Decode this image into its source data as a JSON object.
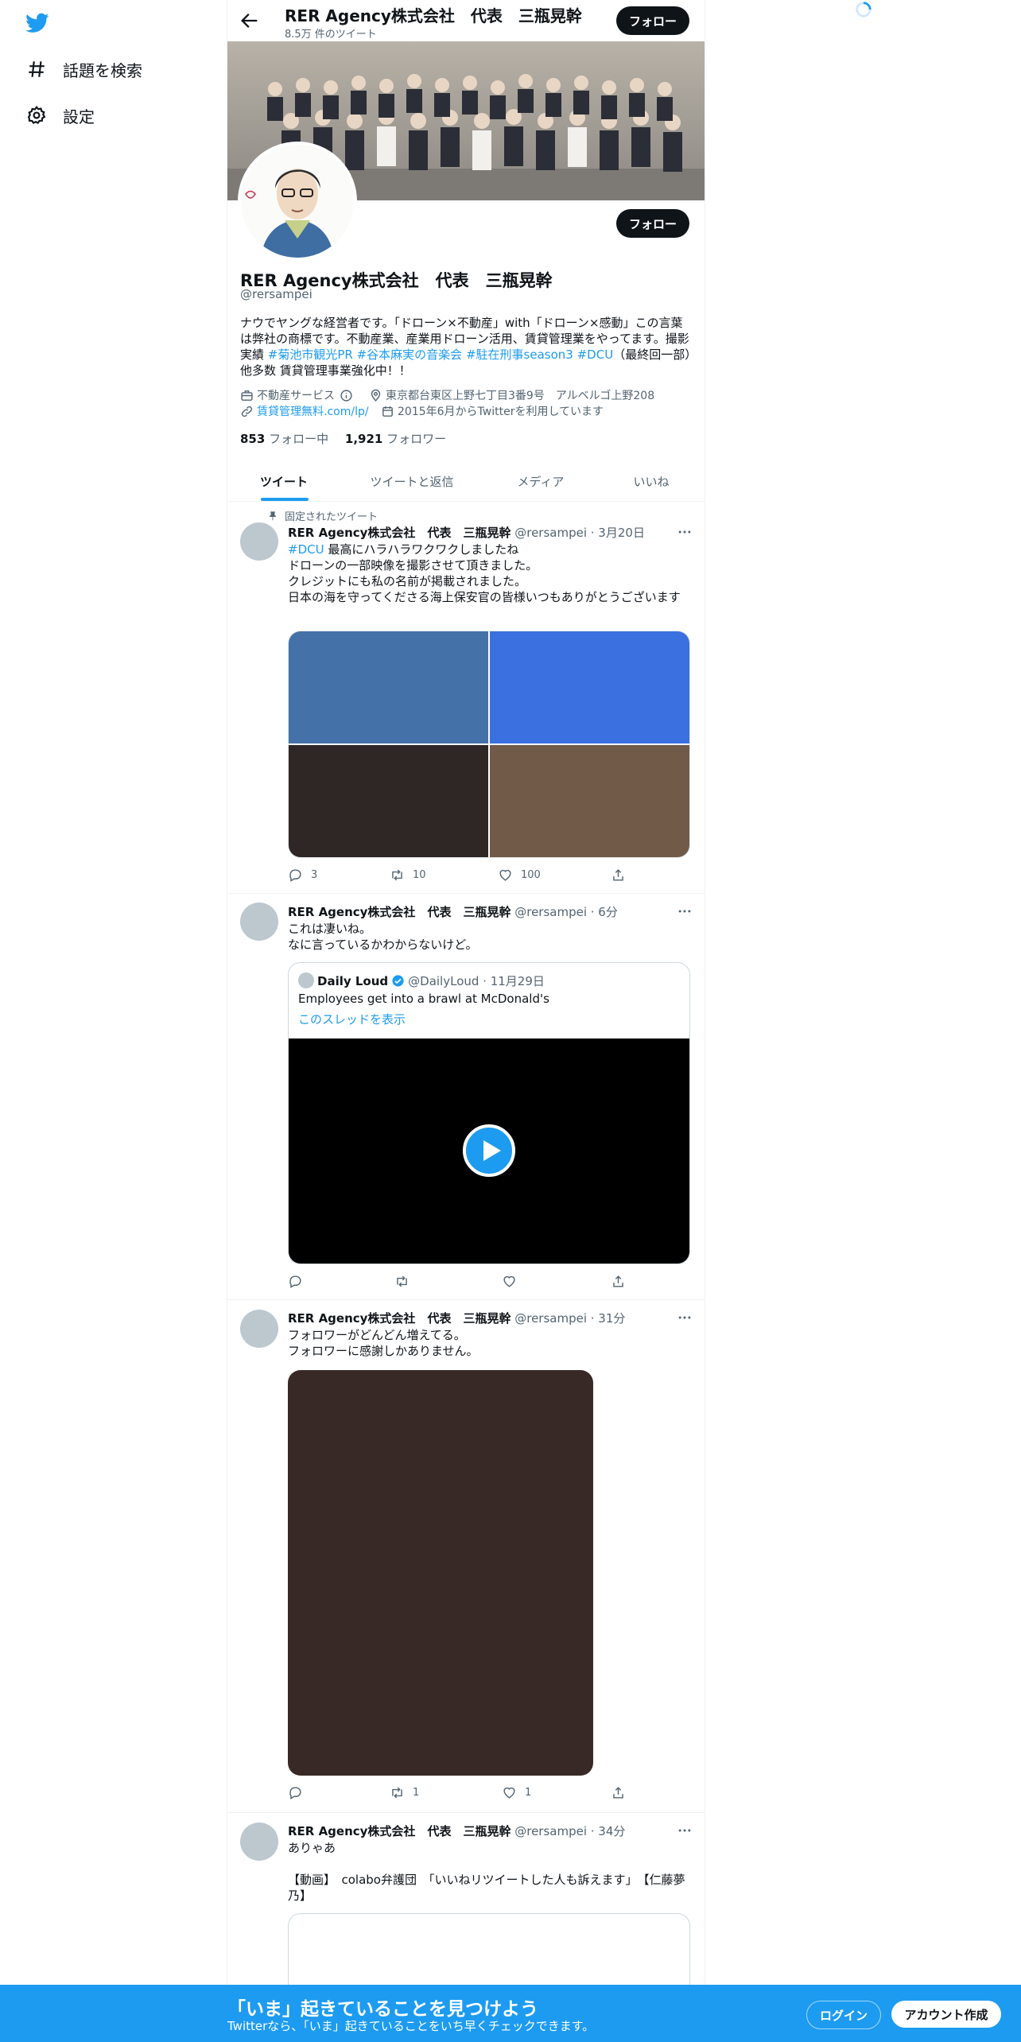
{
  "colors": {
    "brand": "#1d9bf0",
    "text": "#0f1419",
    "secondary": "#536471"
  },
  "sidebar": {
    "logo_icon": "twitter-bird-icon",
    "items": [
      {
        "icon": "hashtag-icon",
        "label": "話題を検索"
      },
      {
        "icon": "gear-icon",
        "label": "設定"
      }
    ]
  },
  "header": {
    "title": "RER Agency株式会社　代表　三瓶晃幹",
    "subtitle": "8.5万 件のツイート",
    "follow_label": "フォロー"
  },
  "profile": {
    "name": "RER Agency株式会社　代表　三瓶晃幹",
    "handle": "@rersampei",
    "follow_label": "フォロー",
    "bio_1": "ナウでヤングな経営者です。「ドローン×不動産」with「ドローン×感動」この言葉は弊社の商標です。不動産業、産業用ドローン活用、賃貸管理業をやってます。撮影実績 ",
    "bio_tag_1": "#菊池市観光PR",
    "bio_tag_2": "#谷本麻実の音楽会",
    "bio_tag_3": "#駐在刑事season3",
    "bio_tag_4": "#DCU",
    "bio_2": "（最終回一部）他多数 賃貸管理事業強化中！！",
    "category": "不動産サービス",
    "location": "東京都台東区上野七丁目3番9号　アルベルゴ上野208",
    "website": "賃貸管理無料.com/lp/",
    "joined": "2015年6月からTwitterを利用しています",
    "following_count": "853",
    "following_label": "フォロー中",
    "followers_count": "1,921",
    "followers_label": "フォロワー"
  },
  "tabs": [
    {
      "label": "ツイート",
      "active": true
    },
    {
      "label": "ツイートと返信",
      "active": false
    },
    {
      "label": "メディア",
      "active": false
    },
    {
      "label": "いいね",
      "active": false
    }
  ],
  "tweets": [
    {
      "pinned_label": "固定されたツイート",
      "author": "RER Agency株式会社　代表　三瓶晃幹",
      "handle_time": "@rersampei · 3月20日",
      "tag": "#DCU",
      "text_first": " 最高にハラハラワクワクしましたね",
      "text_rest": "ドローンの一部映像を撮影させて頂きました。\nクレジットにも私の名前が掲載されました。\n日本の海を守ってくださる海上保安官の皆様いつもありがとうございます",
      "media_colors": [
        "#4472a8",
        "#3a70e0",
        "#2f2725",
        "#715a47"
      ],
      "replies": "3",
      "retweets": "10",
      "likes": "100"
    },
    {
      "author": "RER Agency株式会社　代表　三瓶晃幹",
      "handle_time": "@rersampei · 6分",
      "text": "これは凄いね。\nなに言っているかわからないけど。",
      "quote_author": "Daily Loud",
      "quote_handle_time": "@DailyLoud · 11月29日",
      "quote_text": "Employees get into a brawl at McDonald's",
      "quote_thread": "このスレッドを表示",
      "replies": "",
      "retweets": "",
      "likes": ""
    },
    {
      "author": "RER Agency株式会社　代表　三瓶晃幹",
      "handle_time": "@rersampei · 31分",
      "text": "フォロワーがどんどん増えてる。\nフォロワーに感謝しかありません。",
      "media_color": "#382926",
      "replies": "",
      "retweets": "1",
      "likes": "1"
    },
    {
      "author": "RER Agency株式会社　代表　三瓶晃幹",
      "handle_time": "@rersampei · 34分",
      "text": "ありゃあ\n\n【動画】　colabo弁護団　「いいねリツイートした人も訴えます」　【仁藤夢乃】"
    }
  ],
  "bottom_bar": {
    "title": "「いま」起きていることを見つけよう",
    "subtitle": "Twitterなら、「いま」起きていることをいち早くチェックできます。",
    "login_label": "ログイン",
    "signup_label": "アカウント作成"
  }
}
